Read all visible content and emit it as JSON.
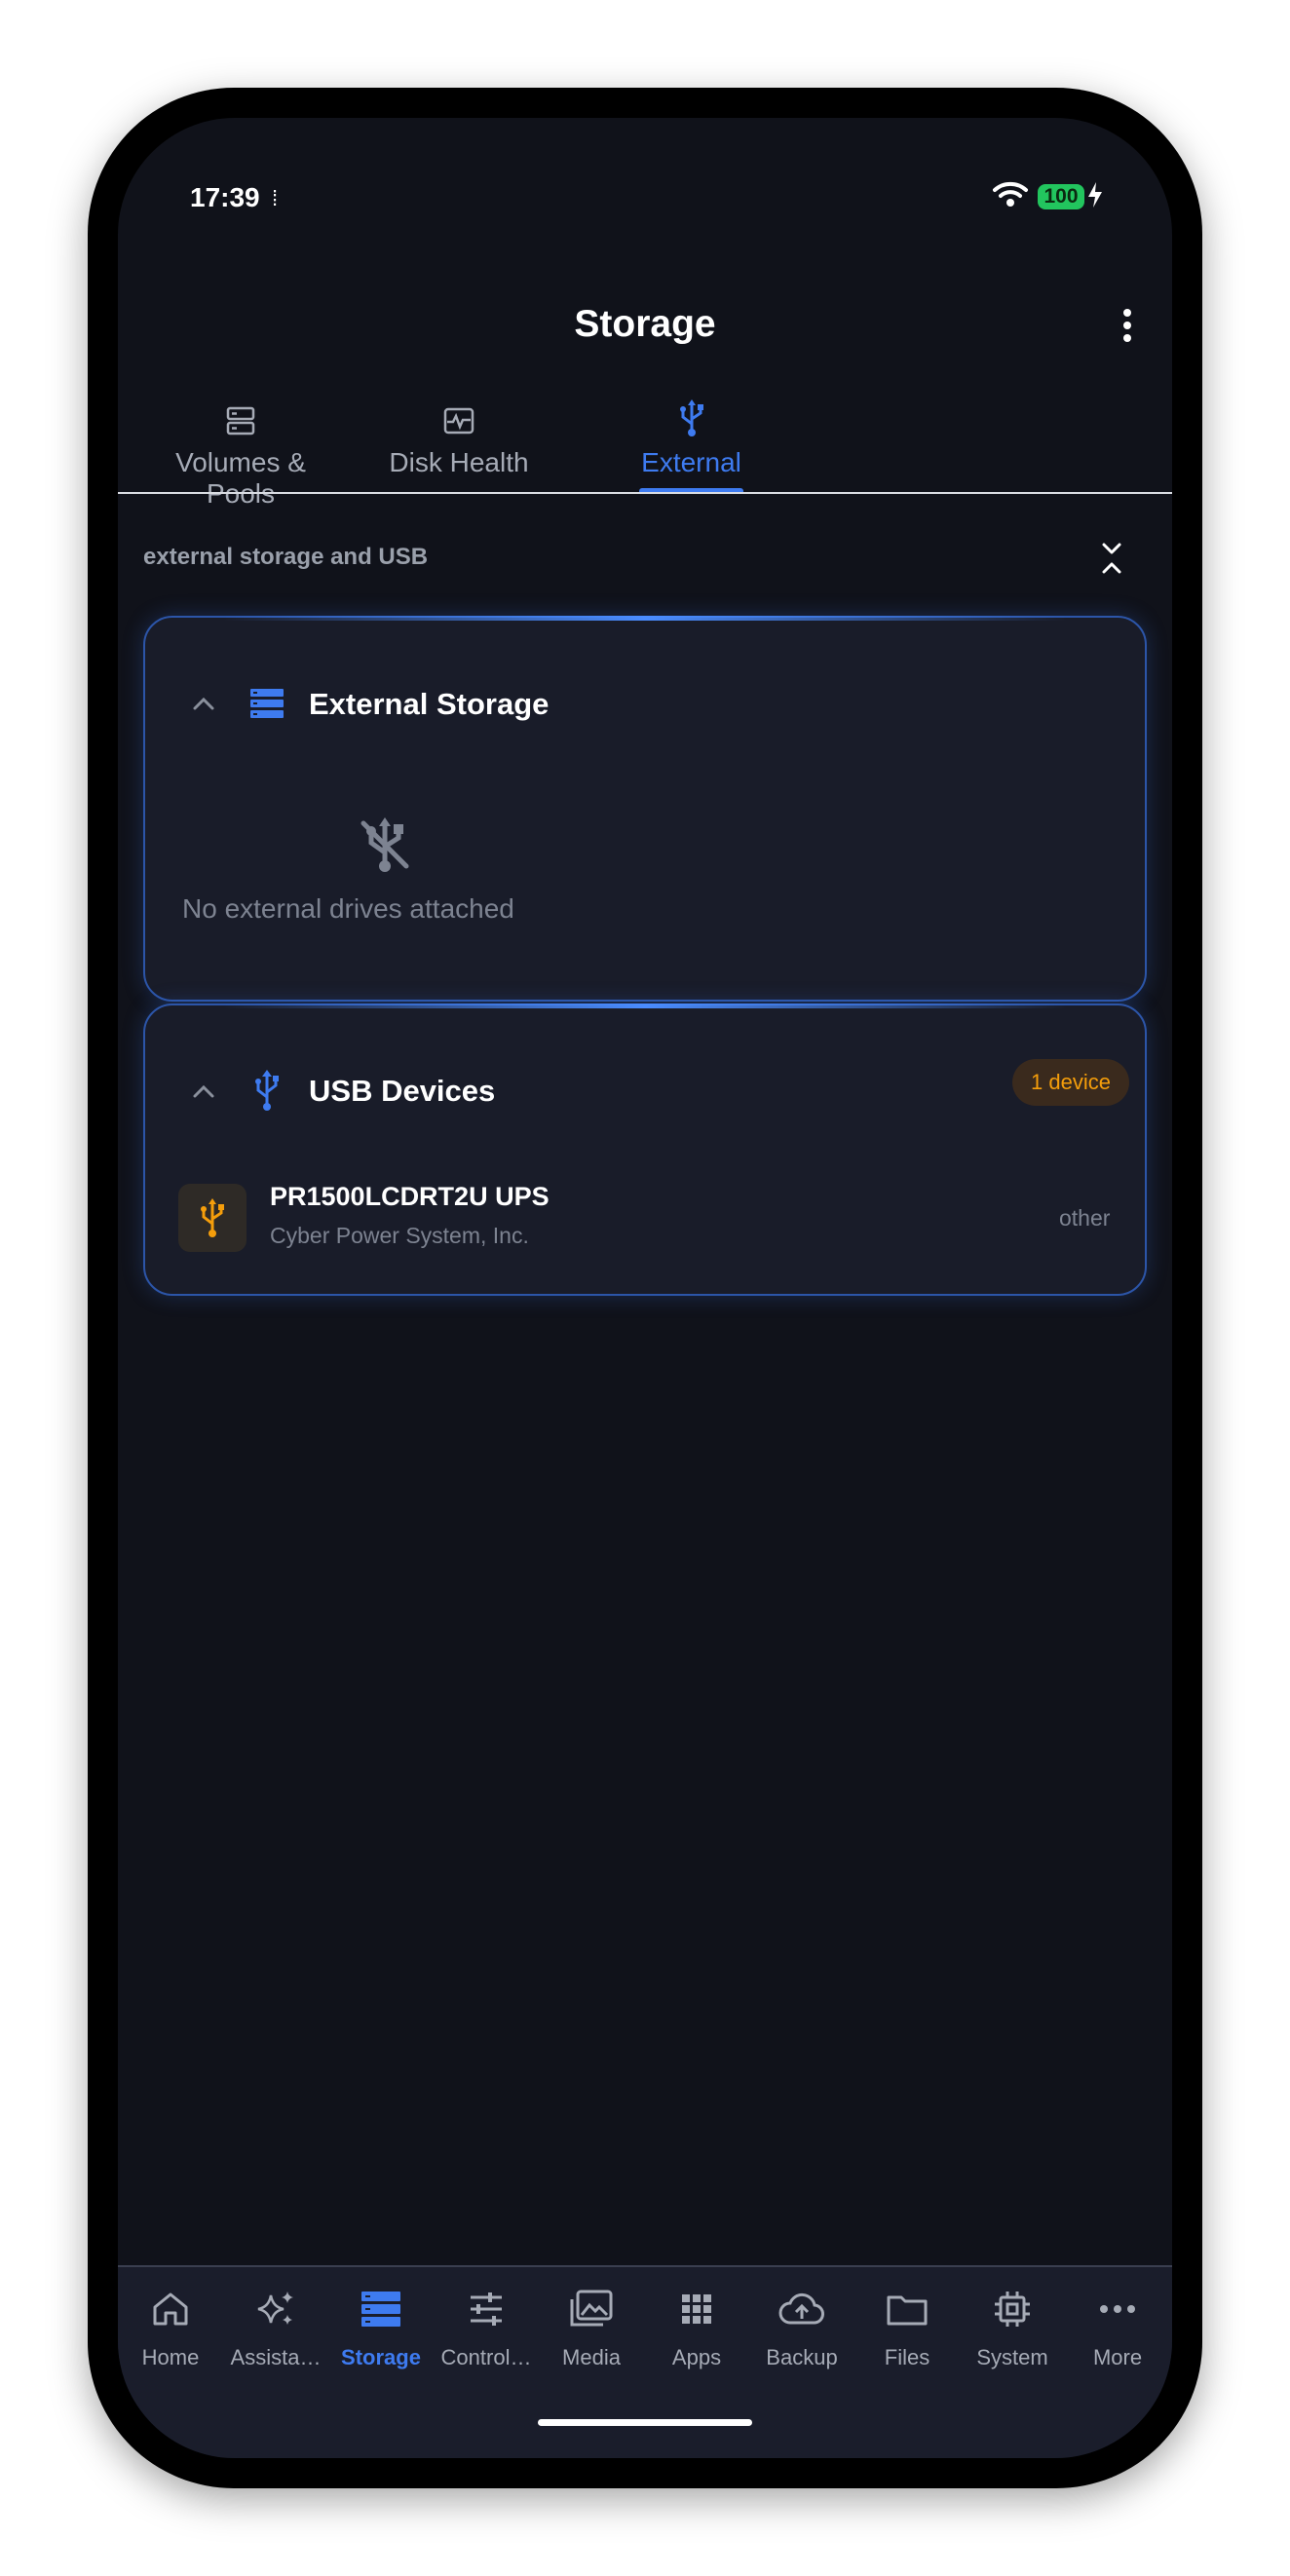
{
  "status_bar": {
    "time": "17:39",
    "extra_indicator": "⁞",
    "battery": "100"
  },
  "header": {
    "title": "Storage",
    "menu_icon": "more-vert-icon"
  },
  "tabs": [
    {
      "label": "Volumes & Pools",
      "icon": "storage-icon",
      "active": false
    },
    {
      "label": "Disk Health",
      "icon": "monitor-heart-icon",
      "active": false
    },
    {
      "label": "External",
      "icon": "usb-icon",
      "active": true
    }
  ],
  "subtitle": "external storage and USB",
  "external_storage": {
    "title": "External Storage",
    "empty_message": "No external drives attached"
  },
  "usb_devices": {
    "title": "USB Devices",
    "badge": "1 device",
    "items": [
      {
        "name": "PR1500LCDRT2U UPS",
        "vendor": "Cyber Power System, Inc.",
        "type": "other"
      }
    ]
  },
  "bottom_nav": [
    {
      "label": "Home",
      "icon": "home-icon",
      "active": false
    },
    {
      "label": "Assista…",
      "icon": "sparkle-icon",
      "active": false
    },
    {
      "label": "Storage",
      "icon": "storage-icon",
      "active": true
    },
    {
      "label": "Control…",
      "icon": "sliders-icon",
      "active": false
    },
    {
      "label": "Media",
      "icon": "photo-library-icon",
      "active": false
    },
    {
      "label": "Apps",
      "icon": "apps-grid-icon",
      "active": false
    },
    {
      "label": "Backup",
      "icon": "cloud-upload-icon",
      "active": false
    },
    {
      "label": "Files",
      "icon": "folder-icon",
      "active": false
    },
    {
      "label": "System",
      "icon": "chip-icon",
      "active": false
    },
    {
      "label": "More",
      "icon": "more-horiz-icon",
      "active": false
    }
  ],
  "colors": {
    "accent": "#3e7bf0",
    "background": "#10121a",
    "card": "#191c29",
    "badge_text": "#f59e0b",
    "battery": "#22c55e"
  }
}
